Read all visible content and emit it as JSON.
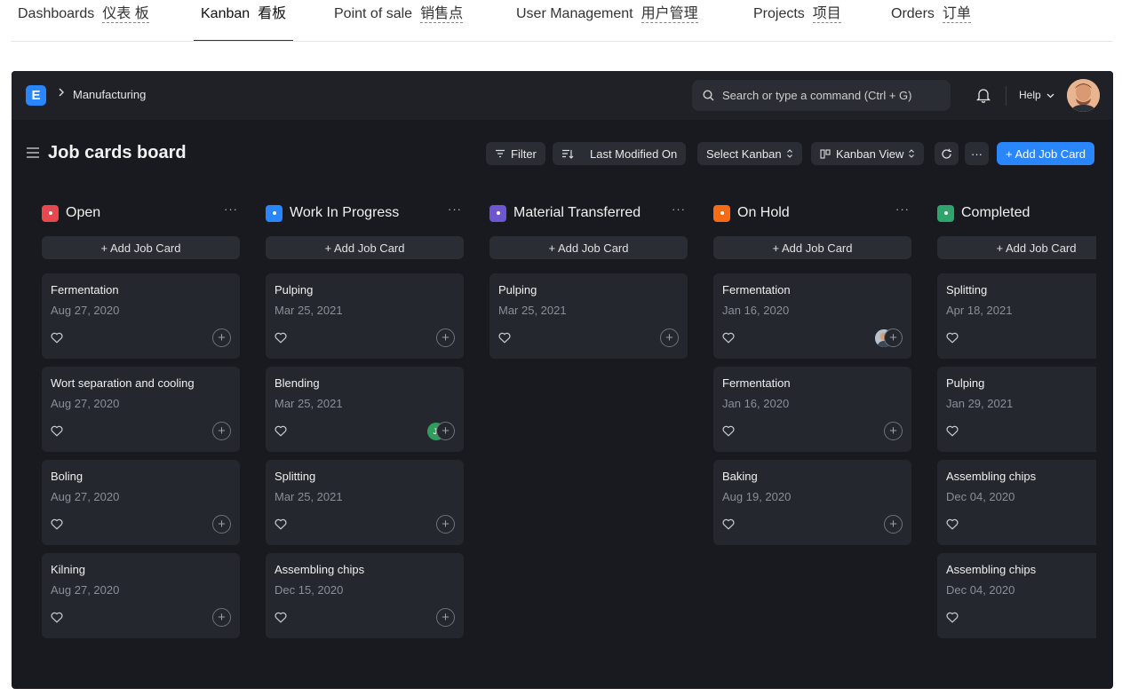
{
  "top_tabs": [
    {
      "en": "Dashboards",
      "zh": "仪表 板"
    },
    {
      "en": "Kanban",
      "zh": "看板"
    },
    {
      "en": "Point of sale",
      "zh": "销售点"
    },
    {
      "en": "User Management",
      "zh": "用户管理"
    },
    {
      "en": "Projects",
      "zh": "项目"
    },
    {
      "en": "Orders",
      "zh": "订单"
    }
  ],
  "app": {
    "logo_letter": "E",
    "breadcrumb": "Manufacturing",
    "search_placeholder": "Search or type a command (Ctrl + G)",
    "help_label": "Help"
  },
  "page": {
    "title": "Job cards board",
    "toolbar": {
      "filter": "Filter",
      "sort": "Last Modified On",
      "select_kanban": "Select Kanban",
      "view": "Kanban View",
      "more": "···",
      "add": "+ Add Job Card"
    }
  },
  "colors": {
    "accent": "#2a86ff",
    "open": "#e5484d",
    "wip": "#2a86ff",
    "material": "#6e56cf",
    "hold": "#f76b15",
    "completed": "#30a46c"
  },
  "add_card_label": "+ Add Job Card",
  "columns": [
    {
      "title": "Open",
      "more": "···",
      "cards": [
        {
          "title": "Fermentation",
          "date": "Aug 27, 2020"
        },
        {
          "title": "Wort separation and cooling",
          "date": "Aug 27, 2020"
        },
        {
          "title": "Boling",
          "date": "Aug 27, 2020"
        },
        {
          "title": "Kilning",
          "date": "Aug 27, 2020"
        }
      ]
    },
    {
      "title": "Work In Progress",
      "more": "···",
      "cards": [
        {
          "title": "Pulping",
          "date": "Mar 25, 2021"
        },
        {
          "title": "Blending",
          "date": "Mar 25, 2021",
          "assignee_initials": "J."
        },
        {
          "title": "Splitting",
          "date": "Mar 25, 2021"
        },
        {
          "title": "Assembling chips",
          "date": "Dec 15, 2020"
        }
      ]
    },
    {
      "title": "Material Transferred",
      "more": "···",
      "cards": [
        {
          "title": "Pulping",
          "date": "Mar 25, 2021"
        }
      ]
    },
    {
      "title": "On Hold",
      "more": "···",
      "cards": [
        {
          "title": "Fermentation",
          "date": "Jan 16, 2020",
          "assignee_photo": true
        },
        {
          "title": "Fermentation",
          "date": "Jan 16, 2020"
        },
        {
          "title": "Baking",
          "date": "Aug 19, 2020"
        }
      ]
    },
    {
      "title": "Completed",
      "more": "",
      "cards": [
        {
          "title": "Splitting",
          "date": "Apr 18, 2021"
        },
        {
          "title": "Pulping",
          "date": "Jan 29, 2021"
        },
        {
          "title": "Assembling chips",
          "date": "Dec 04, 2020"
        },
        {
          "title": "Assembling chips",
          "date": "Dec 04, 2020"
        }
      ]
    }
  ]
}
